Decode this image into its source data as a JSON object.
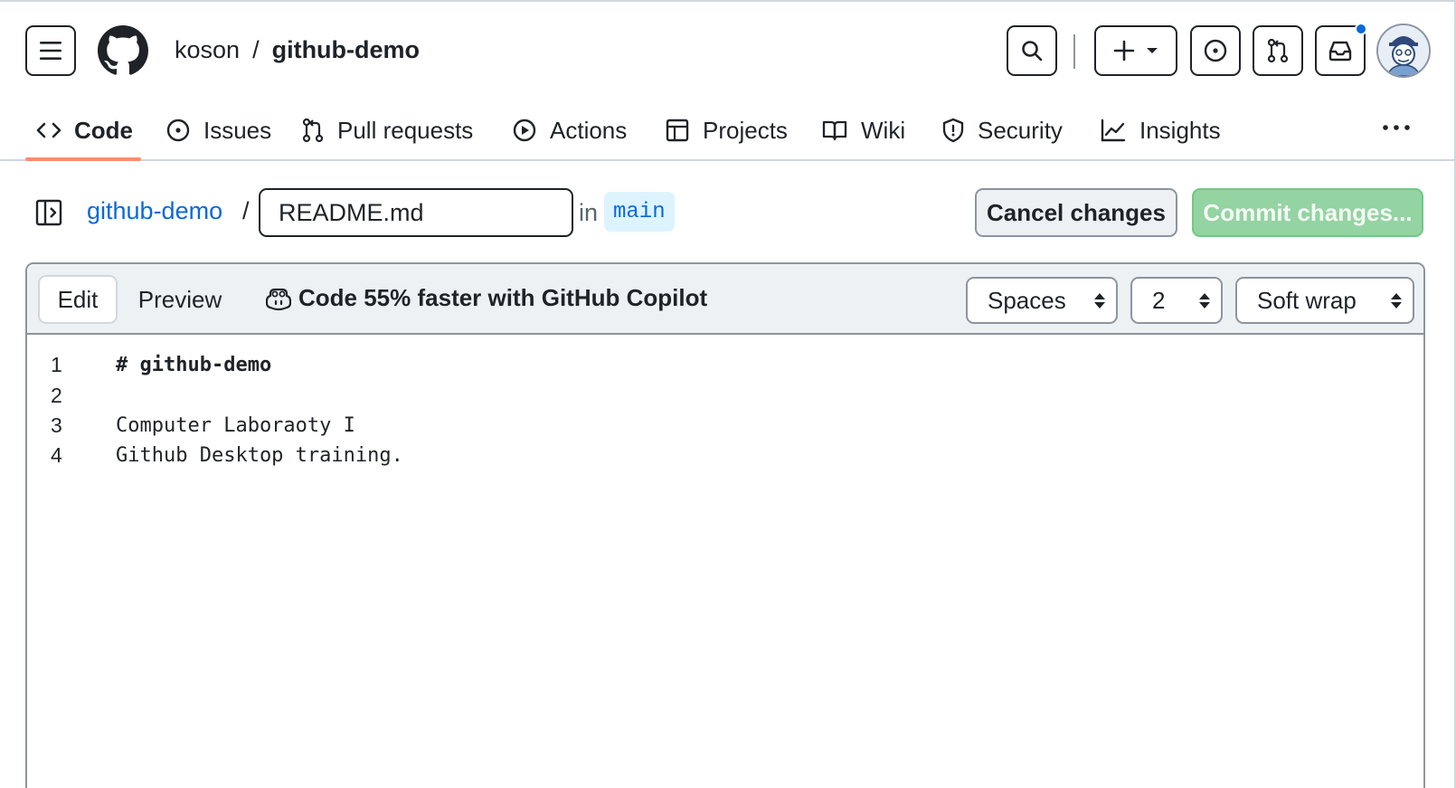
{
  "header": {
    "owner": "koson",
    "separator": "/",
    "repo": "github-demo"
  },
  "nav": {
    "items": [
      {
        "label": "Code",
        "icon": "code-icon",
        "active": true
      },
      {
        "label": "Issues",
        "icon": "issue-icon"
      },
      {
        "label": "Pull requests",
        "icon": "pull-request-icon"
      },
      {
        "label": "Actions",
        "icon": "play-icon"
      },
      {
        "label": "Projects",
        "icon": "table-icon"
      },
      {
        "label": "Wiki",
        "icon": "book-icon"
      },
      {
        "label": "Security",
        "icon": "shield-icon"
      },
      {
        "label": "Insights",
        "icon": "graph-icon"
      }
    ],
    "more_label": "···"
  },
  "filebar": {
    "repo_link": "github-demo",
    "slash": "/",
    "filename": "README.md",
    "in_label": "in",
    "branch": "main",
    "cancel_label": "Cancel changes",
    "commit_label": "Commit changes..."
  },
  "editor": {
    "tabs": {
      "edit": "Edit",
      "preview": "Preview"
    },
    "copilot_label": "Code 55% faster with GitHub Copilot",
    "indent_mode": "Spaces",
    "indent_size": "2",
    "wrap_mode": "Soft wrap",
    "lines": [
      {
        "number": "1",
        "text": "# github-demo"
      },
      {
        "number": "2",
        "text": ""
      },
      {
        "number": "3",
        "text": "Computer Laboraoty I"
      },
      {
        "number": "4",
        "text": "Github Desktop training."
      }
    ]
  },
  "colors": {
    "accent_link": "#0969da",
    "active_tab_underline": "#fd8c73",
    "commit_button_bg": "#94d3a2",
    "branch_bg": "#ddf4ff",
    "notification_dot": "#0969da"
  }
}
